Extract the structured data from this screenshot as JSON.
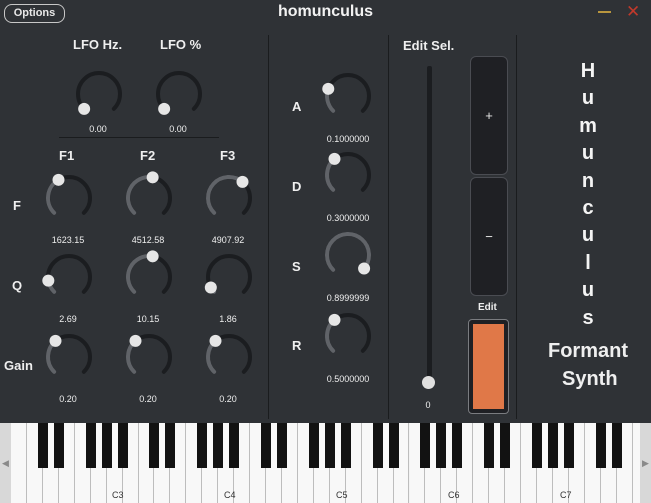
{
  "window": {
    "title": "homunculus",
    "options_label": "Options",
    "minimize_symbol": "—",
    "close_symbol": "✕"
  },
  "lfo": {
    "hz_label": "LFO Hz.",
    "pct_label": "LFO %",
    "hz_value": "0.00",
    "pct_value": "0.00"
  },
  "formants": {
    "columns": [
      "F1",
      "F2",
      "F3"
    ],
    "rows": [
      {
        "label": "F",
        "values": [
          "1623.15",
          "4512.58",
          "4907.92"
        ]
      },
      {
        "label": "Q",
        "values": [
          "2.69",
          "10.15",
          "1.86"
        ]
      },
      {
        "label": "Gain",
        "values": [
          "0.20",
          "0.20",
          "0.20"
        ]
      }
    ]
  },
  "adsr": [
    {
      "label": "A",
      "value": "0.1000000"
    },
    {
      "label": "D",
      "value": "0.3000000"
    },
    {
      "label": "S",
      "value": "0.8999999"
    },
    {
      "label": "R",
      "value": "0.5000000"
    }
  ],
  "edit_selector": {
    "label": "Edit Sel.",
    "slider_value": "0",
    "plus_label": "+",
    "minus_label": "−",
    "edit_label": "Edit",
    "edit_color": "#e07848"
  },
  "branding": {
    "vertical_letters": [
      "H",
      "u",
      "m",
      "u",
      "n",
      "c",
      "u",
      "l",
      "u",
      "s"
    ],
    "line1": "Formant",
    "line2": "Synth"
  },
  "keyboard": {
    "octave_labels": [
      "C3",
      "C4",
      "C5",
      "C6",
      "C7"
    ],
    "left_arrow": "◀",
    "right_arrow": "▶"
  },
  "colors": {
    "background": "#2f3236",
    "knob_track": "#1b1d20",
    "knob_arc": "#606368",
    "knob_thumb": "#e6e6e6",
    "accent": "#e07848"
  }
}
